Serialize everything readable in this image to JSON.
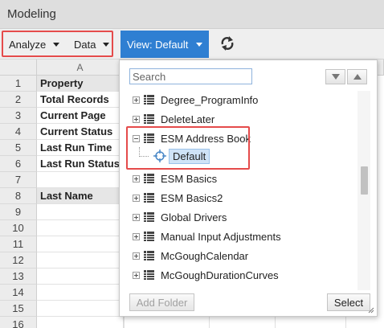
{
  "window": {
    "title": "Modeling"
  },
  "toolbar": {
    "analyze_label": "Analyze",
    "data_label": "Data",
    "view_label": "View: Default",
    "refresh_icon": "refresh-icon",
    "accent_color": "#2f7fd2"
  },
  "sheet": {
    "column_header": "A",
    "rows": [
      {
        "num": "1",
        "value": "Property",
        "shaded": true
      },
      {
        "num": "2",
        "value": "Total Records",
        "shaded": false
      },
      {
        "num": "3",
        "value": "Current Page",
        "shaded": false
      },
      {
        "num": "4",
        "value": "Current Status",
        "shaded": false
      },
      {
        "num": "5",
        "value": "Last Run Time",
        "shaded": false
      },
      {
        "num": "6",
        "value": "Last Run Status",
        "shaded": false
      },
      {
        "num": "7",
        "value": "",
        "shaded": false
      },
      {
        "num": "8",
        "value": "Last Name",
        "shaded": true
      },
      {
        "num": "9",
        "value": "",
        "shaded": false
      },
      {
        "num": "10",
        "value": "",
        "shaded": false
      },
      {
        "num": "11",
        "value": "",
        "shaded": false
      },
      {
        "num": "12",
        "value": "",
        "shaded": false
      },
      {
        "num": "13",
        "value": "",
        "shaded": false
      },
      {
        "num": "14",
        "value": "",
        "shaded": false
      },
      {
        "num": "15",
        "value": "",
        "shaded": false
      },
      {
        "num": "16",
        "value": "",
        "shaded": false
      }
    ]
  },
  "picker": {
    "search_placeholder": "Search",
    "nodes": [
      {
        "label": "Degree_ProgramInfo",
        "expanded": false
      },
      {
        "label": "DeleteLater",
        "expanded": false
      },
      {
        "label": "ESM Address Book",
        "expanded": true,
        "child": "Default"
      },
      {
        "label": "ESM Basics",
        "expanded": false
      },
      {
        "label": "ESM Basics2",
        "expanded": false
      },
      {
        "label": "Global Drivers",
        "expanded": false
      },
      {
        "label": "Manual Input Adjustments",
        "expanded": false
      },
      {
        "label": "McGoughCalendar",
        "expanded": false
      },
      {
        "label": "McGoughDurationCurves",
        "expanded": false
      }
    ],
    "add_folder_label": "Add Folder",
    "select_label": "Select"
  },
  "highlight_color": "#e54b4b"
}
